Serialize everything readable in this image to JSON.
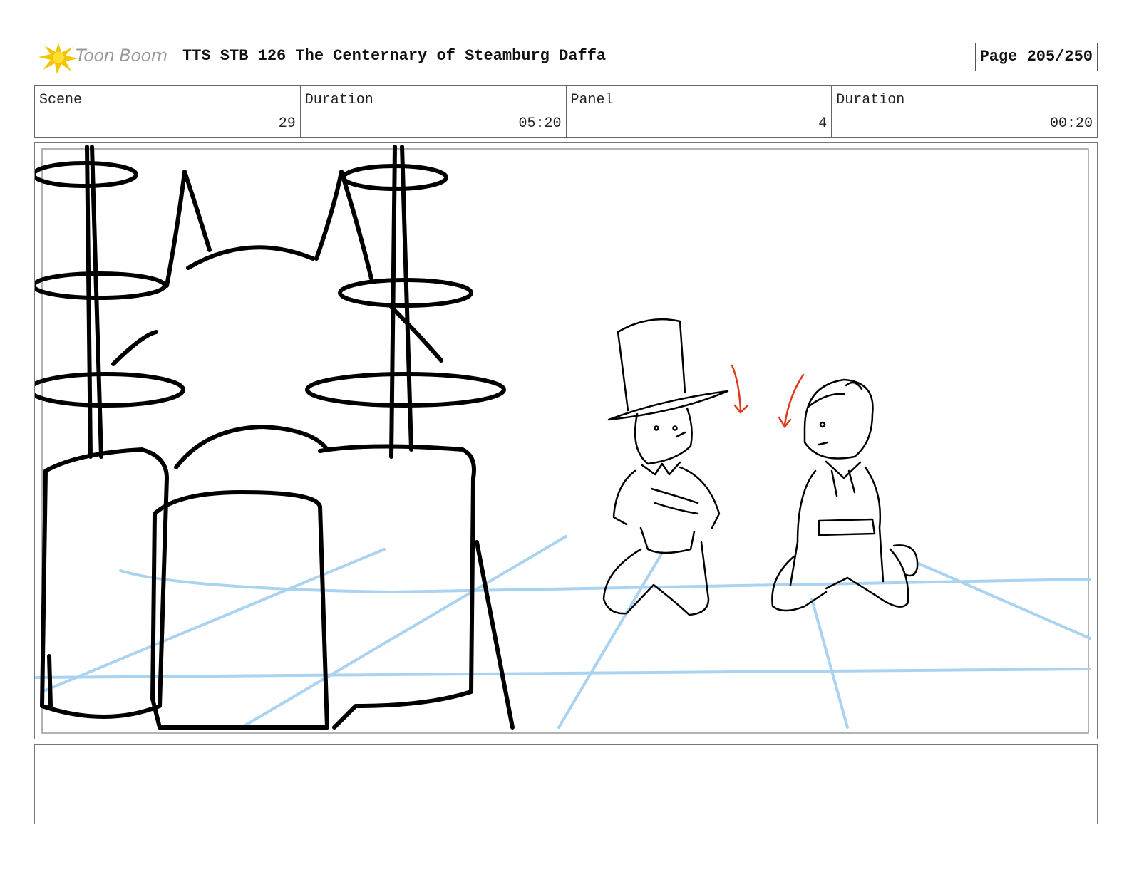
{
  "header": {
    "logo_text": "Toon Boom",
    "title": "TTS STB 126 The Centernary of Steamburg Daffa",
    "page_label": "Page 205/250"
  },
  "info": {
    "scene_label": "Scene",
    "scene_value": "29",
    "scene_duration_label": "Duration",
    "scene_duration_value": "05:20",
    "panel_label": "Panel",
    "panel_value": "4",
    "panel_duration_label": "Duration",
    "panel_duration_value": "00:20"
  },
  "colors": {
    "sketch": "#000000",
    "guide_lines": "#a9d3f0",
    "direction_arrows": "#e03a1e",
    "logo_star": "#f5c400"
  },
  "notes": {
    "text": ""
  }
}
